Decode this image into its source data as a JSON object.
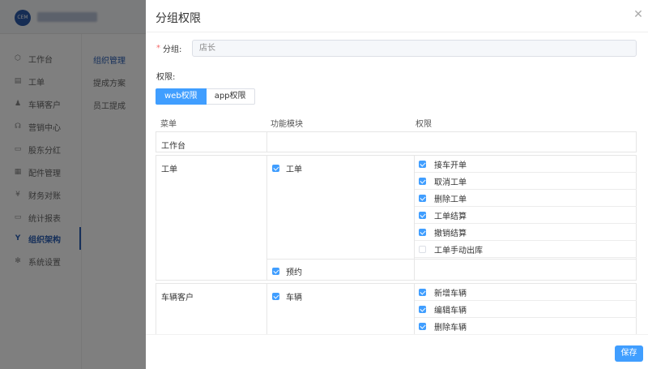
{
  "background": {
    "logo_text": "CEM",
    "nav_items": [
      {
        "label": "工作台",
        "icon": "cube-icon",
        "glyph": "⬡"
      },
      {
        "label": "工单",
        "icon": "document-icon",
        "glyph": "▤"
      },
      {
        "label": "车辆客户",
        "icon": "user-icon",
        "glyph": "♟"
      },
      {
        "label": "营销中心",
        "icon": "headset-icon",
        "glyph": "☊"
      },
      {
        "label": "股东分红",
        "icon": "wallet-icon",
        "glyph": "▭"
      },
      {
        "label": "配件管理",
        "icon": "grid-icon",
        "glyph": "▦"
      },
      {
        "label": "财务对账",
        "icon": "yen-icon",
        "glyph": "¥"
      },
      {
        "label": "统计报表",
        "icon": "monitor-icon",
        "glyph": "▭"
      },
      {
        "label": "组织架构",
        "icon": "org-icon",
        "glyph": "Y"
      },
      {
        "label": "系统设置",
        "icon": "gear-icon",
        "glyph": "✻"
      }
    ],
    "active_nav": "组织架构",
    "sub_items": [
      "组织管理",
      "提成方案",
      "员工提成"
    ]
  },
  "dialog": {
    "title": "分组权限",
    "close_icon": "close-icon",
    "group_label": "分组:",
    "required_mark": "*",
    "group_value": "店长",
    "permissions_label": "权限:",
    "tabs": [
      {
        "label": "web权限",
        "active": true
      },
      {
        "label": "app权限",
        "active": false
      }
    ],
    "headers": {
      "menu": "菜单",
      "module": "功能模块",
      "perm": "权限"
    },
    "rows": [
      {
        "menu": "工作台",
        "modules": []
      },
      {
        "menu": "工单",
        "modules": [
          {
            "label": "工单",
            "checked": true,
            "perms": [
              {
                "label": "接车开单",
                "checked": true
              },
              {
                "label": "取消工单",
                "checked": true
              },
              {
                "label": "删除工单",
                "checked": true
              },
              {
                "label": "工单结算",
                "checked": true
              },
              {
                "label": "撤销结算",
                "checked": true
              },
              {
                "label": "工单手动出库",
                "checked": false
              }
            ]
          },
          {
            "label": "预约",
            "checked": true,
            "perms": []
          }
        ]
      },
      {
        "menu": "车辆客户",
        "modules": [
          {
            "label": "车辆",
            "checked": true,
            "perms": [
              {
                "label": "新增车辆",
                "checked": true
              },
              {
                "label": "编辑车辆",
                "checked": true
              },
              {
                "label": "删除车辆",
                "checked": true
              }
            ]
          }
        ]
      }
    ],
    "save_label": "保存",
    "colors": {
      "primary": "#409eff",
      "required": "#f56c6c",
      "nav_active": "#2b5fb4"
    }
  }
}
